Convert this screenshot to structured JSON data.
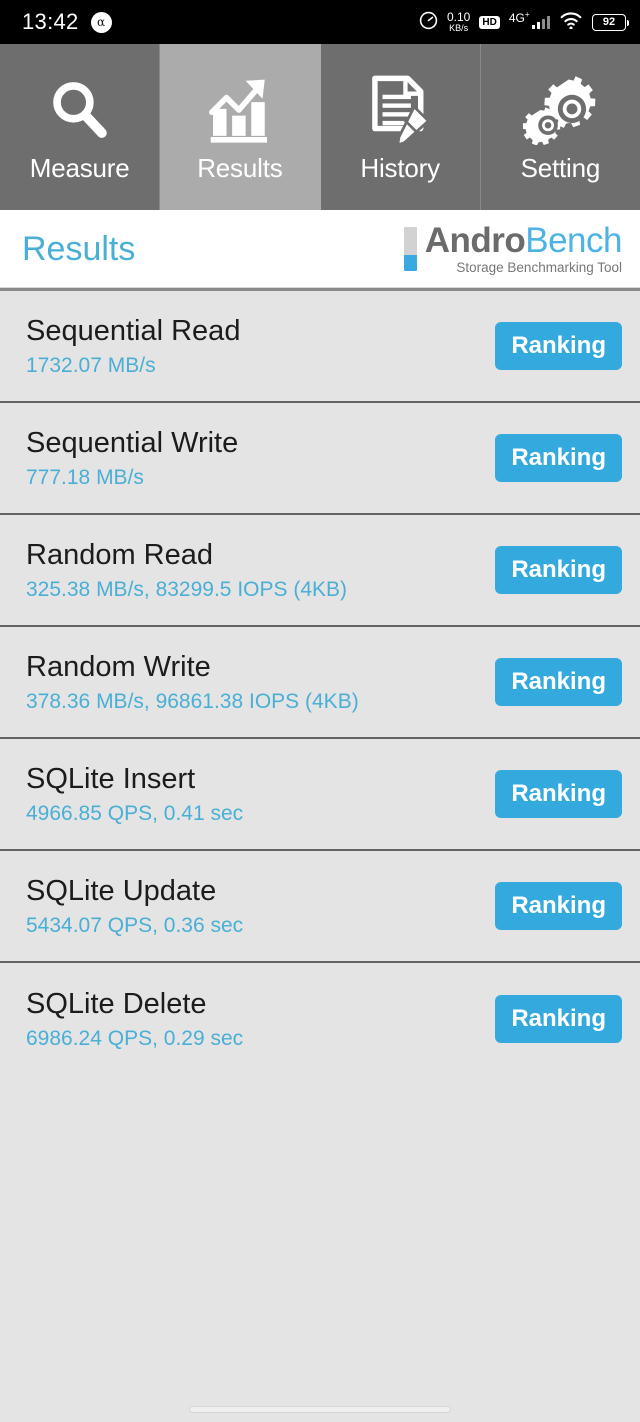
{
  "status_bar": {
    "clock": "13:42",
    "app_badge": "α",
    "net_speed_value": "0.10",
    "net_speed_unit": "KB/s",
    "hd_label": "HD",
    "network_type": "4G",
    "network_superscript": "+",
    "battery_level": "92"
  },
  "tabs": [
    {
      "label": "Measure",
      "icon": "search-icon",
      "active": false
    },
    {
      "label": "Results",
      "icon": "chart-growth-icon",
      "active": true
    },
    {
      "label": "History",
      "icon": "document-pencil-icon",
      "active": false
    },
    {
      "label": "Setting",
      "icon": "gears-icon",
      "active": false
    }
  ],
  "header": {
    "page_title": "Results",
    "brand_first": "Andro",
    "brand_second": "Bench",
    "brand_tagline": "Storage Benchmarking Tool"
  },
  "colors": {
    "accent_blue": "#33a9dd",
    "value_blue": "#4aafd6",
    "tab_inactive": "#6e6e6e",
    "tab_active": "#ababab",
    "list_background": "#e4e4e4"
  },
  "results": [
    {
      "name": "Sequential Read",
      "value": "1732.07 MB/s",
      "action": "Ranking"
    },
    {
      "name": "Sequential Write",
      "value": "777.18 MB/s",
      "action": "Ranking"
    },
    {
      "name": "Random Read",
      "value": "325.38 MB/s, 83299.5 IOPS (4KB)",
      "action": "Ranking"
    },
    {
      "name": "Random Write",
      "value": "378.36 MB/s, 96861.38 IOPS (4KB)",
      "action": "Ranking"
    },
    {
      "name": "SQLite Insert",
      "value": "4966.85 QPS, 0.41 sec",
      "action": "Ranking"
    },
    {
      "name": "SQLite Update",
      "value": "5434.07 QPS, 0.36 sec",
      "action": "Ranking"
    },
    {
      "name": "SQLite Delete",
      "value": "6986.24 QPS, 0.29 sec",
      "action": "Ranking"
    }
  ]
}
